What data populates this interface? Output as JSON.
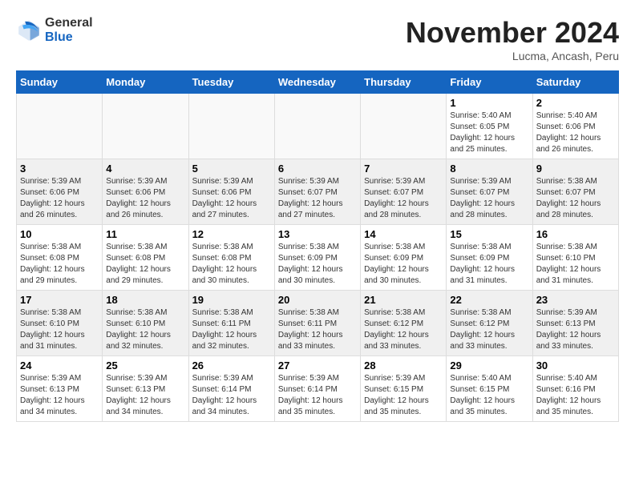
{
  "header": {
    "logo_general": "General",
    "logo_blue": "Blue",
    "month_title": "November 2024",
    "location": "Lucma, Ancash, Peru"
  },
  "days_of_week": [
    "Sunday",
    "Monday",
    "Tuesday",
    "Wednesday",
    "Thursday",
    "Friday",
    "Saturday"
  ],
  "weeks": [
    [
      {
        "day": "",
        "info": ""
      },
      {
        "day": "",
        "info": ""
      },
      {
        "day": "",
        "info": ""
      },
      {
        "day": "",
        "info": ""
      },
      {
        "day": "",
        "info": ""
      },
      {
        "day": "1",
        "info": "Sunrise: 5:40 AM\nSunset: 6:05 PM\nDaylight: 12 hours and 25 minutes."
      },
      {
        "day": "2",
        "info": "Sunrise: 5:40 AM\nSunset: 6:06 PM\nDaylight: 12 hours and 26 minutes."
      }
    ],
    [
      {
        "day": "3",
        "info": "Sunrise: 5:39 AM\nSunset: 6:06 PM\nDaylight: 12 hours and 26 minutes."
      },
      {
        "day": "4",
        "info": "Sunrise: 5:39 AM\nSunset: 6:06 PM\nDaylight: 12 hours and 26 minutes."
      },
      {
        "day": "5",
        "info": "Sunrise: 5:39 AM\nSunset: 6:06 PM\nDaylight: 12 hours and 27 minutes."
      },
      {
        "day": "6",
        "info": "Sunrise: 5:39 AM\nSunset: 6:07 PM\nDaylight: 12 hours and 27 minutes."
      },
      {
        "day": "7",
        "info": "Sunrise: 5:39 AM\nSunset: 6:07 PM\nDaylight: 12 hours and 28 minutes."
      },
      {
        "day": "8",
        "info": "Sunrise: 5:39 AM\nSunset: 6:07 PM\nDaylight: 12 hours and 28 minutes."
      },
      {
        "day": "9",
        "info": "Sunrise: 5:38 AM\nSunset: 6:07 PM\nDaylight: 12 hours and 28 minutes."
      }
    ],
    [
      {
        "day": "10",
        "info": "Sunrise: 5:38 AM\nSunset: 6:08 PM\nDaylight: 12 hours and 29 minutes."
      },
      {
        "day": "11",
        "info": "Sunrise: 5:38 AM\nSunset: 6:08 PM\nDaylight: 12 hours and 29 minutes."
      },
      {
        "day": "12",
        "info": "Sunrise: 5:38 AM\nSunset: 6:08 PM\nDaylight: 12 hours and 30 minutes."
      },
      {
        "day": "13",
        "info": "Sunrise: 5:38 AM\nSunset: 6:09 PM\nDaylight: 12 hours and 30 minutes."
      },
      {
        "day": "14",
        "info": "Sunrise: 5:38 AM\nSunset: 6:09 PM\nDaylight: 12 hours and 30 minutes."
      },
      {
        "day": "15",
        "info": "Sunrise: 5:38 AM\nSunset: 6:09 PM\nDaylight: 12 hours and 31 minutes."
      },
      {
        "day": "16",
        "info": "Sunrise: 5:38 AM\nSunset: 6:10 PM\nDaylight: 12 hours and 31 minutes."
      }
    ],
    [
      {
        "day": "17",
        "info": "Sunrise: 5:38 AM\nSunset: 6:10 PM\nDaylight: 12 hours and 31 minutes."
      },
      {
        "day": "18",
        "info": "Sunrise: 5:38 AM\nSunset: 6:10 PM\nDaylight: 12 hours and 32 minutes."
      },
      {
        "day": "19",
        "info": "Sunrise: 5:38 AM\nSunset: 6:11 PM\nDaylight: 12 hours and 32 minutes."
      },
      {
        "day": "20",
        "info": "Sunrise: 5:38 AM\nSunset: 6:11 PM\nDaylight: 12 hours and 33 minutes."
      },
      {
        "day": "21",
        "info": "Sunrise: 5:38 AM\nSunset: 6:12 PM\nDaylight: 12 hours and 33 minutes."
      },
      {
        "day": "22",
        "info": "Sunrise: 5:38 AM\nSunset: 6:12 PM\nDaylight: 12 hours and 33 minutes."
      },
      {
        "day": "23",
        "info": "Sunrise: 5:39 AM\nSunset: 6:13 PM\nDaylight: 12 hours and 33 minutes."
      }
    ],
    [
      {
        "day": "24",
        "info": "Sunrise: 5:39 AM\nSunset: 6:13 PM\nDaylight: 12 hours and 34 minutes."
      },
      {
        "day": "25",
        "info": "Sunrise: 5:39 AM\nSunset: 6:13 PM\nDaylight: 12 hours and 34 minutes."
      },
      {
        "day": "26",
        "info": "Sunrise: 5:39 AM\nSunset: 6:14 PM\nDaylight: 12 hours and 34 minutes."
      },
      {
        "day": "27",
        "info": "Sunrise: 5:39 AM\nSunset: 6:14 PM\nDaylight: 12 hours and 35 minutes."
      },
      {
        "day": "28",
        "info": "Sunrise: 5:39 AM\nSunset: 6:15 PM\nDaylight: 12 hours and 35 minutes."
      },
      {
        "day": "29",
        "info": "Sunrise: 5:40 AM\nSunset: 6:15 PM\nDaylight: 12 hours and 35 minutes."
      },
      {
        "day": "30",
        "info": "Sunrise: 5:40 AM\nSunset: 6:16 PM\nDaylight: 12 hours and 35 minutes."
      }
    ]
  ]
}
